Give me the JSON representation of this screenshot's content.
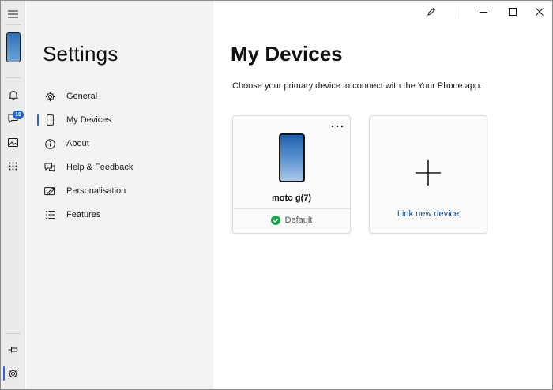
{
  "settings": {
    "title": "Settings",
    "nav": [
      {
        "label": "General",
        "icon": "gear-icon"
      },
      {
        "label": "My Devices",
        "icon": "phone-icon",
        "selected": true
      },
      {
        "label": "About",
        "icon": "info-icon"
      },
      {
        "label": "Help & Feedback",
        "icon": "help-chat-icon"
      },
      {
        "label": "Personalisation",
        "icon": "paint-icon"
      },
      {
        "label": "Features",
        "icon": "list-icon"
      }
    ]
  },
  "rail": {
    "messages_badge": "10"
  },
  "main": {
    "title": "My Devices",
    "subtitle": "Choose your primary device to connect with the Your Phone app.",
    "devices": [
      {
        "name": "moto g(7)",
        "status": "Default"
      }
    ],
    "link_new_label": "Link new device"
  },
  "colors": {
    "accent": "#2d6ac4",
    "success": "#16a34a",
    "link": "#1d4f86"
  }
}
